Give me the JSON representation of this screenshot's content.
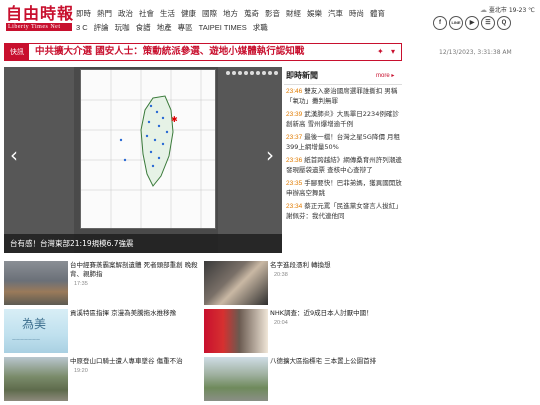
{
  "header": {
    "logo_cn": "自由時報",
    "logo_en": "Liberty Times Net",
    "nav_row1": [
      "即時",
      "熱門",
      "政治",
      "社會",
      "生活",
      "健康",
      "國際",
      "地方",
      "蒐奇",
      "影音",
      "財經",
      "娛樂",
      "汽車",
      "時尚",
      "體育"
    ],
    "nav_row2": [
      "3 C",
      "評論",
      "玩咖",
      "食譜",
      "地產",
      "專區",
      "TAIPEI TIMES",
      "求職"
    ],
    "weather": "臺北市 19-23 ℃",
    "social": [
      "f",
      "LINE",
      "▶",
      "☰",
      "Q"
    ]
  },
  "breaking": {
    "tag": "快訊",
    "text": "中共擴大介選 國安人士：策動統派參選、遊地小媒體執行認知戰"
  },
  "timestamp": "12/13/2023, 3:31:38 AM",
  "carousel": {
    "caption": "台有感！台灣東部21:19規模6.7強震",
    "prev": "‹",
    "next": "›"
  },
  "instant": {
    "title": "即時新聞",
    "more": "more ▸",
    "items": [
      {
        "time": "23:46",
        "text": "雙友入麥治國席選罪誰撕扣 男稱「氧功」攤判無罪"
      },
      {
        "time": "23:39",
        "text": "武漢肺炎》大馬單日2234例確診創新高 雪州爆增逾千例"
      },
      {
        "time": "23:37",
        "text": "最後一檔！台灣之星5G降價 月租399上網增量50%"
      },
      {
        "time": "23:36",
        "text": "紙首跨越結》網傳桑育州許列潮邊發現壓袋遺票 查核中心查辯了"
      },
      {
        "time": "23:35",
        "text": "手腳要快！巴菲弟媽，獲異國開放申辦高空舞跳"
      },
      {
        "time": "23:34",
        "text": "蔡正元罵「民進黨女發言人拔紅」謝佩芬：我代連他同"
      }
    ]
  },
  "articles": [
    {
      "title": "台中經賽蒸霸案解剖遺體 死者頭部重創 晚殺背、親肺指",
      "time": "17:35"
    },
    {
      "title": "名字進段憑利 轉換想",
      "time": "20:38"
    },
    {
      "title": "貢溪特區指揮 京漫為美騰拖水推移豫",
      "time": ""
    },
    {
      "title": "NHK調查：近9成日本人討厭中國！",
      "time": "20:04"
    },
    {
      "title": "中原登山口騎士遭人專車墜谷 傷重不治",
      "time": "19:20"
    },
    {
      "title": "八德擴大區指標宅 三本置上公園首排",
      "time": ""
    }
  ],
  "colors": {
    "brand": "#c8102e",
    "time": "#e07b00"
  }
}
